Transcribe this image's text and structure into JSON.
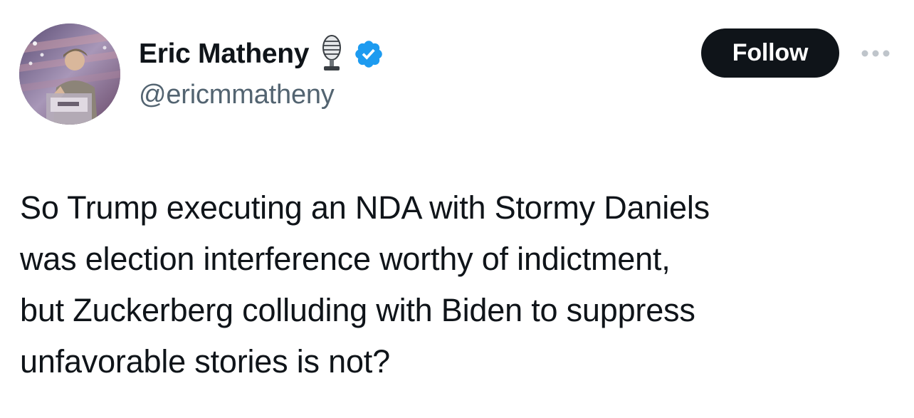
{
  "author": {
    "display_name": "Eric Matheny",
    "handle": "@ericmmatheny",
    "name_emoji_icon": "studio-microphone-icon",
    "badge_icon": "verified-badge-icon",
    "avatar_icon": "profile-avatar"
  },
  "actions": {
    "follow_label": "Follow",
    "more_icon": "more-options-icon"
  },
  "tweet": {
    "text_lines": [
      "So Trump executing an NDA with Stormy Daniels",
      "was election interference worthy of indictment,",
      "but Zuckerberg colluding with Biden to suppress",
      "unfavorable stories is not?"
    ]
  },
  "colors": {
    "text_primary": "#0f1419",
    "text_secondary": "#536471",
    "follow_bg": "#0f1419",
    "follow_text": "#ffffff",
    "verified_blue": "#1d9bf0",
    "more_dots": "#bfc5cb"
  }
}
